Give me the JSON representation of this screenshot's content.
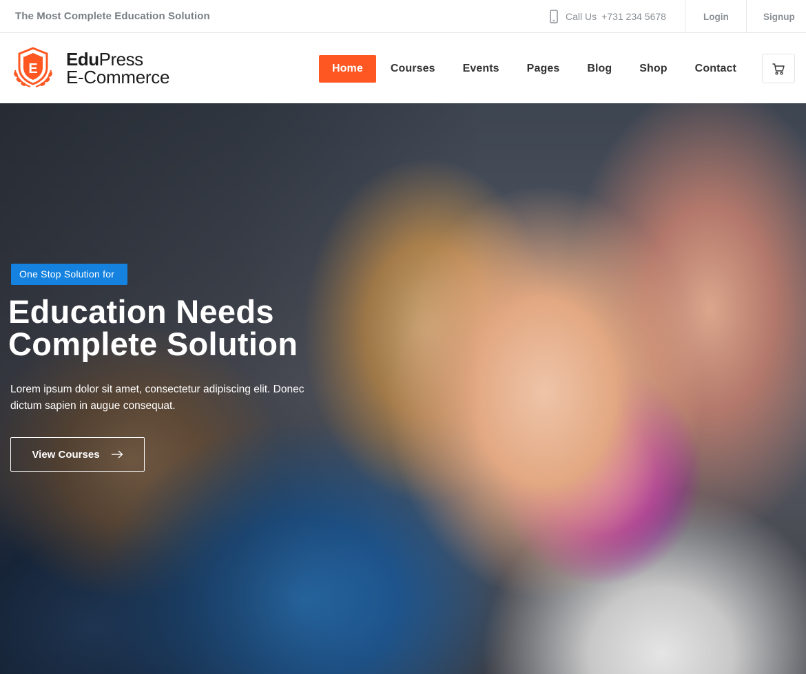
{
  "topbar": {
    "tagline": "The Most Complete Education Solution",
    "call_label": "Call Us",
    "phone": "+731 234 5678",
    "login": "Login",
    "signup": "Signup"
  },
  "header": {
    "logo_letter": "E",
    "brand_bold": "Edu",
    "brand_regular": "Press",
    "brand_line2": "E-Commerce",
    "nav": [
      "Home",
      "Courses",
      "Events",
      "Pages",
      "Blog",
      "Shop",
      "Contact"
    ],
    "active_nav": "Home"
  },
  "hero": {
    "badge": "One Stop Solution for",
    "headline_line1": "Education Needs",
    "headline_line2": "Complete Solution",
    "description": "Lorem ipsum dolor sit amet, consectetur adipiscing elit. Donec dictum sapien in augue consequat.",
    "cta_label": "View Courses"
  },
  "colors": {
    "accent": "#ff5722",
    "badge_blue": "#1582e0",
    "text_muted": "#8a8f95"
  },
  "icons": {
    "phone": "phone-icon",
    "cart": "cart-icon",
    "cta_arrow": "arrow-right-icon",
    "logo": "shield-laurel-logo-icon"
  }
}
